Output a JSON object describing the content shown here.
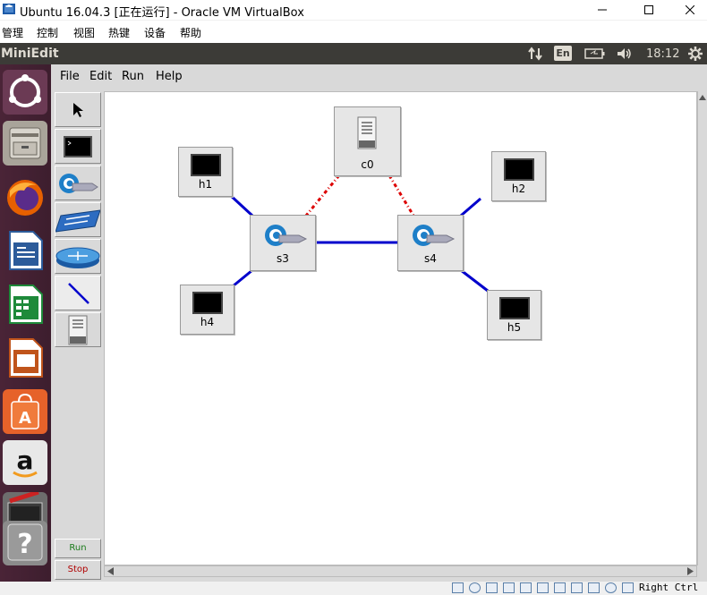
{
  "window": {
    "title": "Ubuntu 16.04.3 [正在运行] - Oracle VM VirtualBox",
    "host_menu": [
      "管理",
      "控制",
      "视图",
      "热键",
      "设备",
      "帮助"
    ]
  },
  "panel": {
    "app_name": "MiniEdit",
    "keyboard": "En",
    "time": "18:12"
  },
  "launcher": {
    "items": [
      "ubuntu-dash",
      "files",
      "firefox",
      "libreoffice-writer",
      "libreoffice-calc",
      "libreoffice-impress",
      "software-center",
      "amazon",
      "system-settings",
      "help"
    ]
  },
  "miniedit": {
    "menu": [
      "File",
      "Edit",
      "Run",
      "Help"
    ],
    "palette": [
      "select",
      "host",
      "switch",
      "legacy-switch",
      "legacy-router",
      "netlink",
      "controller"
    ],
    "run_label": "Run",
    "stop_label": "Stop",
    "nodes": {
      "c0": "c0",
      "h1": "h1",
      "h2": "h2",
      "s3": "s3",
      "s4": "s4",
      "h4": "h4",
      "h5": "h5"
    }
  },
  "statusbar": {
    "host_key": "Right Ctrl"
  },
  "colors": {
    "link": "#0000cc",
    "control_link": "#dd0000",
    "panel_bg": "#3c3b37",
    "launcher_bg": "#4a2437",
    "run_text": "#1a7a1a",
    "stop_text": "#b00000"
  }
}
